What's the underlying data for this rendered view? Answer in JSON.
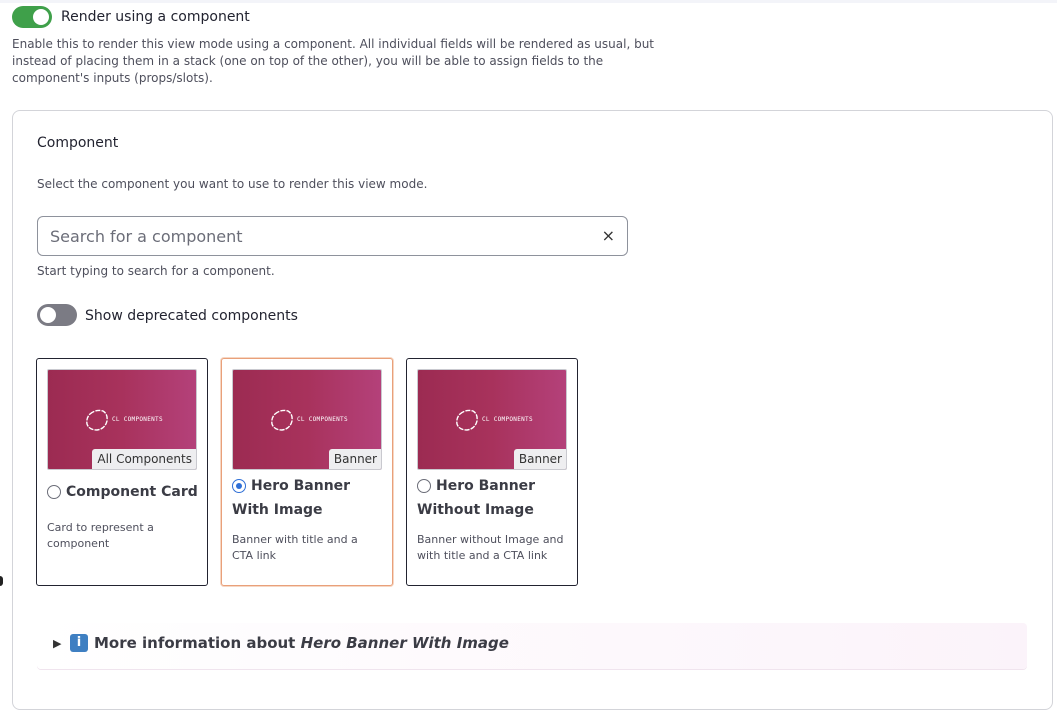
{
  "render_toggle": {
    "label": "Render using a component",
    "enabled": true,
    "description": "Enable this to render this view mode using a component. All individual fields will be rendered as usual, but instead of placing them in a stack (one on top of the other), you will be able to assign fields to the component's inputs (props/slots)."
  },
  "component": {
    "title": "Component",
    "description": "Select the component you want to use to render this view mode.",
    "search": {
      "placeholder": "Search for a component",
      "value": "",
      "clear_icon": "×"
    },
    "search_help": "Start typing to search for a component.",
    "deprecated_toggle": {
      "label": "Show deprecated components",
      "enabled": false
    }
  },
  "brand_mark": "CL COMPONENTS",
  "cards": [
    {
      "name": "Component Card",
      "badge": "All Components",
      "description": "Card to represent a component",
      "selected": false
    },
    {
      "name": "Hero Banner With Image",
      "badge": "Banner",
      "description": "Banner with title and a CTA link",
      "selected": true
    },
    {
      "name": "Hero Banner Without Image",
      "badge": "Banner",
      "description": "Banner without Image and with title and a CTA link",
      "selected": false
    }
  ],
  "more_info": {
    "arrow_icon": "▶",
    "info_icon": "i",
    "prefix": "More information about ",
    "component_name": "Hero Banner With Image"
  },
  "colors": {
    "toggle_on": "#3fa04a",
    "toggle_off": "#7b7b84",
    "radio_selected": "#2f6fd6",
    "selected_card_border": "#e9a07a",
    "thumbnail": "#a8325c"
  }
}
